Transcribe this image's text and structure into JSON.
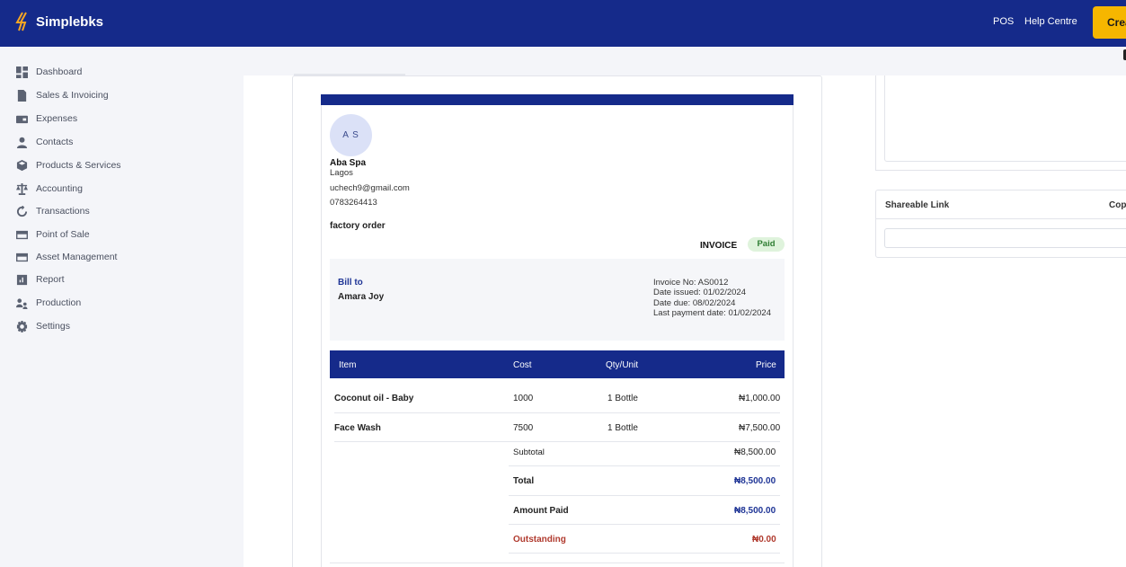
{
  "brand": {
    "name": "Simplebks",
    "accent": "#152a8a",
    "button_color": "#f6b600"
  },
  "header": {
    "nav": [
      "POS",
      "Help Centre"
    ],
    "create_label": "Create"
  },
  "sidebar": {
    "items": [
      {
        "label": "Dashboard",
        "icon": "dashboard-icon"
      },
      {
        "label": "Sales & Invoicing",
        "icon": "document-icon"
      },
      {
        "label": "Expenses",
        "icon": "wallet-icon"
      },
      {
        "label": "Contacts",
        "icon": "person-icon"
      },
      {
        "label": "Products & Services",
        "icon": "box-icon"
      },
      {
        "label": "Accounting",
        "icon": "scale-icon"
      },
      {
        "label": "Transactions",
        "icon": "refresh-icon"
      },
      {
        "label": "Point of Sale",
        "icon": "card-icon"
      },
      {
        "label": "Asset Management",
        "icon": "card-icon"
      },
      {
        "label": "Report",
        "icon": "report-icon"
      },
      {
        "label": "Production",
        "icon": "people-icon"
      },
      {
        "label": "Settings",
        "icon": "gear-icon"
      }
    ]
  },
  "invoice": {
    "initials": "A S",
    "business_name": "Aba Spa",
    "business_city": "Lagos",
    "business_email": "uchech9@gmail.com",
    "business_phone": "0783264413",
    "note": "factory order",
    "title": "INVOICE",
    "status": "Paid",
    "bill_to_label": "Bill to",
    "customer": "Amara Joy",
    "meta": {
      "number": "Invoice No: AS0012",
      "issued": "Date issued: 01/02/2024",
      "due": "Date due: 08/02/2024",
      "last_payment": "Last payment date: 01/02/2024"
    },
    "columns": [
      "Item",
      "Cost",
      "Qty/Unit",
      "Price"
    ],
    "rows": [
      {
        "item": "Coconut oil - Baby",
        "cost": "1000",
        "qty": "1 Bottle",
        "price": "₦1,000.00"
      },
      {
        "item": "Face Wash",
        "cost": "7500",
        "qty": "1 Bottle",
        "price": "₦7,500.00"
      }
    ],
    "totals": {
      "subtotal_label": "Subtotal",
      "subtotal": "₦8,500.00",
      "total_label": "Total",
      "total": "₦8,500.00",
      "paid_label": "Amount Paid",
      "paid": "₦8,500.00",
      "outstanding_label": "Outstanding",
      "outstanding": "₦0.00"
    }
  },
  "right_panel": {
    "share_title": "Shareable Link",
    "copy_label": "Copy"
  }
}
